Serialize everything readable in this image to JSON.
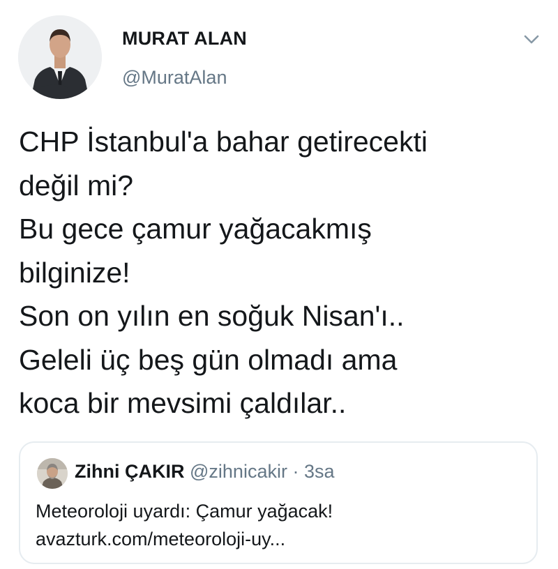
{
  "tweet": {
    "author_name": "MURAT ALAN",
    "author_handle": "@MuratAlan",
    "text_lines": [
      "CHP İstanbul'a bahar getirecekti",
      "değil mi?",
      "Bu gece çamur yağacakmış",
      "bilginize!",
      "Son on yılın en soğuk Nisan'ı..",
      "Geleli üç beş gün olmadı ama",
      "koca bir mevsimi çaldılar.."
    ]
  },
  "quoted_tweet": {
    "author_name": "Zihni ÇAKIR",
    "author_handle": "@zihnicakir",
    "separator": "·",
    "time": "3sa",
    "text": "Meteoroloji uyardı: Çamur yağacak!",
    "link": "avazturk.com/meteoroloji-uy..."
  },
  "icons": {
    "menu": "chevron-down-icon"
  },
  "colors": {
    "text_primary": "#14171a",
    "text_secondary": "#657786",
    "border": "#e6ecf0"
  }
}
